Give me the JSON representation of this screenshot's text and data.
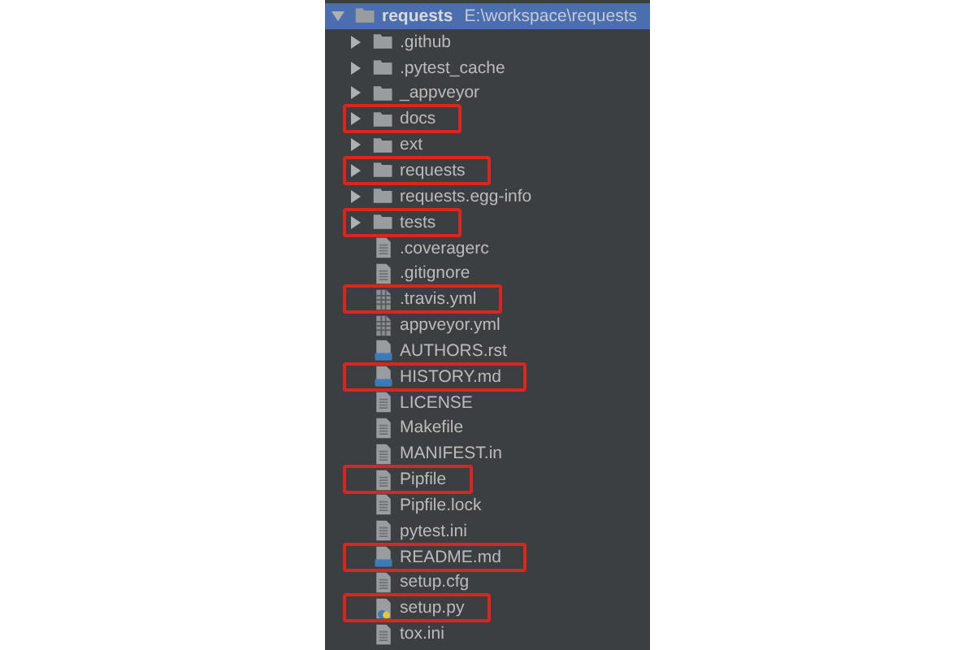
{
  "project_tree": {
    "name": "requests",
    "path": "E:\\workspace\\requests",
    "kind": "folder",
    "expanded": true,
    "selected": true,
    "highlighted": false,
    "children": [
      {
        "name": ".github",
        "kind": "folder",
        "expanded": false,
        "selected": false,
        "highlighted": false
      },
      {
        "name": ".pytest_cache",
        "kind": "folder",
        "expanded": false,
        "selected": false,
        "highlighted": false
      },
      {
        "name": "_appveyor",
        "kind": "folder",
        "expanded": false,
        "selected": false,
        "highlighted": false
      },
      {
        "name": "docs",
        "kind": "folder",
        "expanded": false,
        "selected": false,
        "highlighted": true
      },
      {
        "name": "ext",
        "kind": "folder",
        "expanded": false,
        "selected": false,
        "highlighted": false
      },
      {
        "name": "requests",
        "kind": "folder",
        "expanded": false,
        "selected": false,
        "highlighted": true
      },
      {
        "name": "requests.egg-info",
        "kind": "folder",
        "expanded": false,
        "selected": false,
        "highlighted": false
      },
      {
        "name": "tests",
        "kind": "folder",
        "expanded": false,
        "selected": false,
        "highlighted": true
      },
      {
        "name": ".coveragerc",
        "kind": "text",
        "selected": false,
        "highlighted": false
      },
      {
        "name": ".gitignore",
        "kind": "text",
        "selected": false,
        "highlighted": false
      },
      {
        "name": ".travis.yml",
        "kind": "yaml",
        "selected": false,
        "highlighted": true
      },
      {
        "name": "appveyor.yml",
        "kind": "yaml",
        "selected": false,
        "highlighted": false
      },
      {
        "name": "AUTHORS.rst",
        "kind": "doc",
        "selected": false,
        "highlighted": false
      },
      {
        "name": "HISTORY.md",
        "kind": "doc",
        "selected": false,
        "highlighted": true
      },
      {
        "name": "LICENSE",
        "kind": "text",
        "selected": false,
        "highlighted": false
      },
      {
        "name": "Makefile",
        "kind": "text",
        "selected": false,
        "highlighted": false
      },
      {
        "name": "MANIFEST.in",
        "kind": "text",
        "selected": false,
        "highlighted": false
      },
      {
        "name": "Pipfile",
        "kind": "text",
        "selected": false,
        "highlighted": true
      },
      {
        "name": "Pipfile.lock",
        "kind": "text",
        "selected": false,
        "highlighted": false
      },
      {
        "name": "pytest.ini",
        "kind": "text",
        "selected": false,
        "highlighted": false
      },
      {
        "name": "README.md",
        "kind": "doc",
        "selected": false,
        "highlighted": true
      },
      {
        "name": "setup.cfg",
        "kind": "text",
        "selected": false,
        "highlighted": false
      },
      {
        "name": "setup.py",
        "kind": "python",
        "selected": false,
        "highlighted": true
      },
      {
        "name": "tox.ini",
        "kind": "text",
        "selected": false,
        "highlighted": false
      }
    ]
  }
}
